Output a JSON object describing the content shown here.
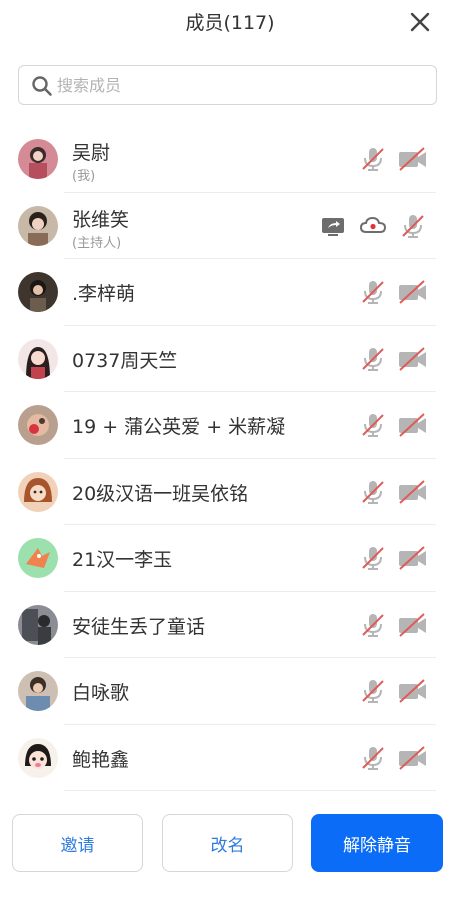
{
  "header": {
    "title": "成员(117)"
  },
  "search": {
    "placeholder": "搜索成员"
  },
  "members": [
    {
      "name": "吴尉",
      "sub": "(我)",
      "avatar_color": "#b54f5e",
      "mic": "muted",
      "cam": "off"
    },
    {
      "name": "张维笑",
      "sub": "(主持人)",
      "avatar_color": "#8a6b58",
      "host": true
    },
    {
      "name": ".李梓萌",
      "sub": "",
      "avatar_color": "#6b5c4e",
      "mic": "muted",
      "cam": "off"
    },
    {
      "name": "0737周天竺",
      "sub": "",
      "avatar_color": "#d9a8a8",
      "mic": "muted",
      "cam": "off"
    },
    {
      "name": "19 + 蒲公英爱 + 米薪凝",
      "sub": "",
      "avatar_color": "#c98c6e",
      "mic": "muted",
      "cam": "off"
    },
    {
      "name": "20级汉语一班吴依铭",
      "sub": "",
      "avatar_color": "#c9774d",
      "mic": "muted",
      "cam": "off"
    },
    {
      "name": "21汉一李玉",
      "sub": "",
      "avatar_color": "#8fd19e",
      "mic": "muted",
      "cam": "off"
    },
    {
      "name": "安徒生丢了童话",
      "sub": "",
      "avatar_color": "#5c5f66",
      "mic": "muted",
      "cam": "off"
    },
    {
      "name": "白咏歌",
      "sub": "",
      "avatar_color": "#7a6a5e",
      "mic": "muted",
      "cam": "off"
    },
    {
      "name": "鲍艳鑫",
      "sub": "",
      "avatar_color": "#efe3d8",
      "mic": "muted",
      "cam": "off"
    }
  ],
  "footer": {
    "invite_label": "邀请",
    "rename_label": "改名",
    "unmute_label": "解除静音"
  },
  "colors": {
    "accent": "#0a6cf7",
    "link": "#2f7be0",
    "muted_slash": "#e05a5a",
    "icon_grey": "#b5b5b5"
  }
}
